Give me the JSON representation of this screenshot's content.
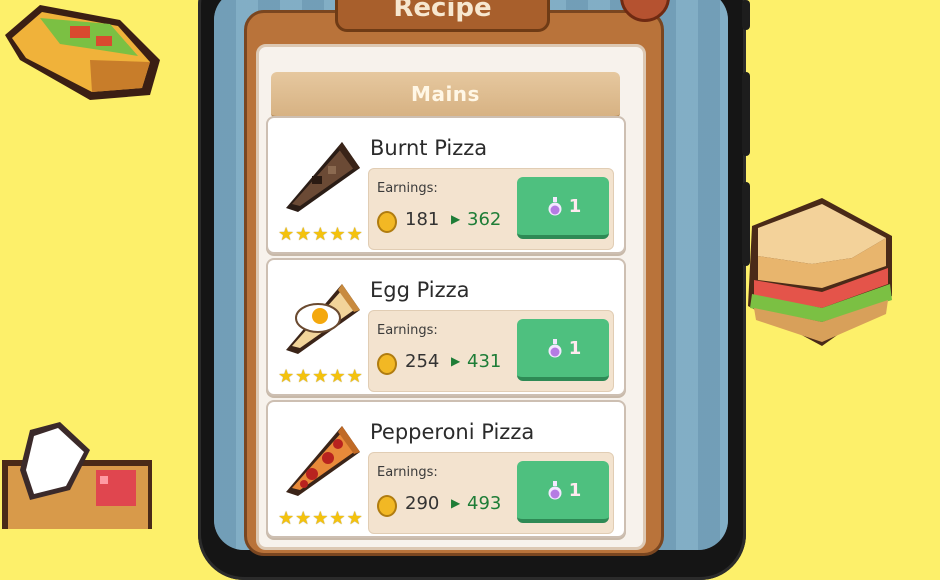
{
  "panel": {
    "title": "Recipe",
    "section": "Mains"
  },
  "recipes": [
    {
      "name": "Burnt Pizza",
      "earnings_label": "Earnings:",
      "current": "181",
      "next": "362",
      "cost": "1",
      "stars": 5,
      "icon": "burnt-pizza-icon"
    },
    {
      "name": "Egg Pizza",
      "earnings_label": "Earnings:",
      "current": "254",
      "next": "431",
      "cost": "1",
      "stars": 5,
      "icon": "egg-pizza-icon"
    },
    {
      "name": "Pepperoni Pizza",
      "earnings_label": "Earnings:",
      "current": "290",
      "next": "493",
      "cost": "1",
      "stars": 5,
      "icon": "pepperoni-pizza-icon"
    }
  ],
  "colors": {
    "background": "#fdf06a",
    "panel": "#b9733a",
    "button": "#4ec07f",
    "earn_next": "#1e7d37"
  }
}
